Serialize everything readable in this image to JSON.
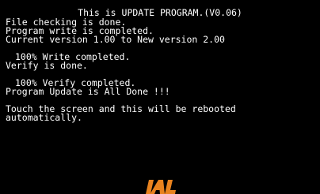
{
  "header": {
    "title": "This is UPDATE PROGRAM.(V0.06)"
  },
  "log": {
    "file_check": "File checking is done.",
    "program_write": "Program write is completed.",
    "version_change": "Current version 1.00 to New version 2.00",
    "write_progress": "100% Write completed.",
    "verify_done": "Verify is done.",
    "verify_progress": "100% Verify completed.",
    "update_done": "Program Update is All Done !!!",
    "reboot_line1": "Touch the screen and this will be rebooted",
    "reboot_line2": "automatically."
  },
  "brand": {
    "logo_text": "IAI",
    "logo_color": "#e8821e"
  }
}
